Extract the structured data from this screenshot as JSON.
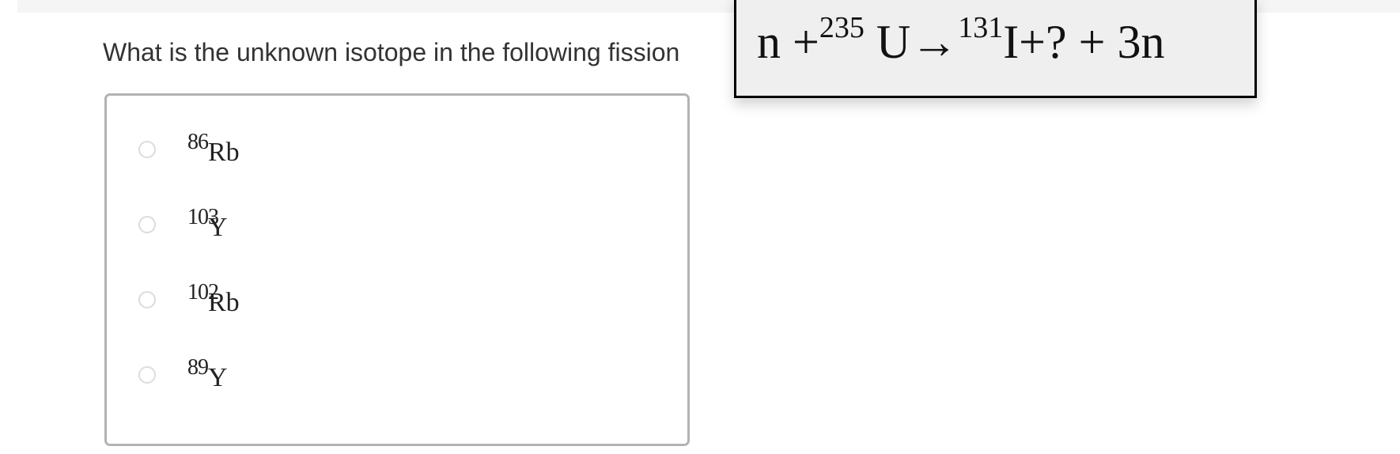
{
  "question": {
    "text": "What is the unknown isotope in the following fission"
  },
  "options": [
    {
      "mass": "86",
      "symbol": "Rb",
      "selected": false
    },
    {
      "mass": "103",
      "symbol": "Y",
      "selected": false
    },
    {
      "mass": "102",
      "symbol": "Rb",
      "selected": false
    },
    {
      "mass": "89",
      "symbol": "Y",
      "selected": false
    }
  ],
  "equation": {
    "part1": "n +",
    "mass1": "235",
    "part2": " U→",
    "mass2": "131",
    "part3": "I+? + 3n"
  }
}
